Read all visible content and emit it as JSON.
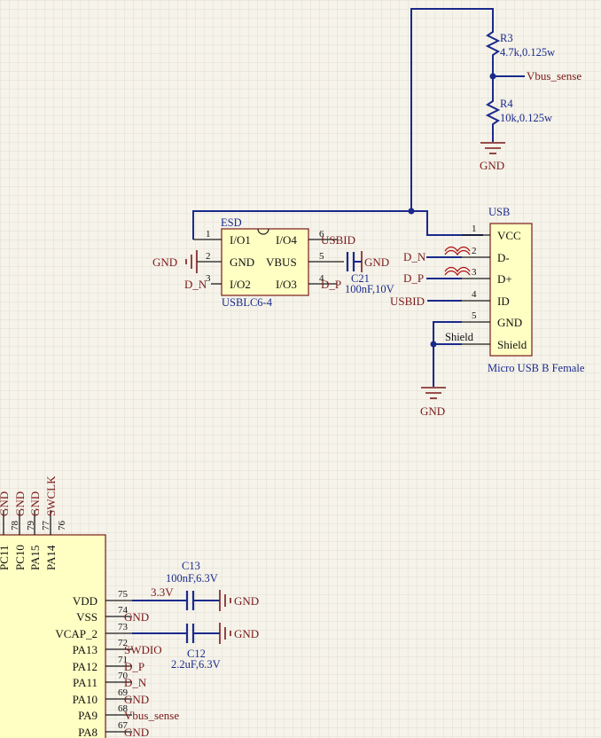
{
  "resistors": {
    "r3": {
      "designator": "R3",
      "value": "4.7k,0.125w"
    },
    "r4": {
      "designator": "R4",
      "value": "10k,0.125w"
    }
  },
  "nets": {
    "vbus_sense": "Vbus_sense",
    "gnd": "GND",
    "usbid": "USBID",
    "d_n": "D_N",
    "d_p": "D_P",
    "shield": "Shield",
    "v33": "3.3V",
    "swdio": "SWDIO",
    "swclk": "SWCLK"
  },
  "esd": {
    "designator": "ESD",
    "part": "USBLC6-4",
    "pins": [
      {
        "num": "1",
        "name": "I/O1"
      },
      {
        "num": "2",
        "name": "GND"
      },
      {
        "num": "3",
        "name": "I/O2"
      },
      {
        "num": "4",
        "name": "I/O3"
      },
      {
        "num": "5",
        "name": "VBUS"
      },
      {
        "num": "6",
        "name": "I/O4"
      }
    ]
  },
  "c21": {
    "designator": "C21",
    "value": "100nF,10V"
  },
  "usb": {
    "designator": "USB",
    "part": "Micro USB B Female",
    "pins": [
      {
        "num": "1",
        "name": "VCC"
      },
      {
        "num": "2",
        "name": "D-"
      },
      {
        "num": "3",
        "name": "D+"
      },
      {
        "num": "4",
        "name": "ID"
      },
      {
        "num": "5",
        "name": "GND"
      },
      {
        "num": "",
        "name": "Shield"
      }
    ]
  },
  "mcu": {
    "top_pins": [
      {
        "num": "78",
        "name": "PC11",
        "net": "GND"
      },
      {
        "num": "79",
        "name": "PC10",
        "net": "GND"
      },
      {
        "num": "77",
        "name": "PA15",
        "net": "GND"
      },
      {
        "num": "76",
        "name": "PA14",
        "net": "SWCLK"
      }
    ],
    "right_pins": [
      {
        "num": "75",
        "name": "VDD",
        "net": "3.3V"
      },
      {
        "num": "74",
        "name": "VSS",
        "net": "GND"
      },
      {
        "num": "73",
        "name": "VCAP_2",
        "net": ""
      },
      {
        "num": "72",
        "name": "PA13",
        "net": "SWDIO"
      },
      {
        "num": "71",
        "name": "PA12",
        "net": "D_P"
      },
      {
        "num": "70",
        "name": "PA11",
        "net": "D_N"
      },
      {
        "num": "69",
        "name": "PA10",
        "net": "GND"
      },
      {
        "num": "68",
        "name": "PA9",
        "net": "Vbus_sense"
      },
      {
        "num": "67",
        "name": "PA8",
        "net": "GND"
      }
    ]
  },
  "c13": {
    "designator": "C13",
    "value": "100nF,6.3V"
  },
  "c12": {
    "designator": "C12",
    "value": "2.2uF,6.3V"
  },
  "colors": {
    "wire": "#1a2a8c",
    "net_label": "#7a1a1a",
    "component_body": "#ffffc4",
    "grid": "#ddd8cc",
    "background": "#f5f3ea"
  }
}
